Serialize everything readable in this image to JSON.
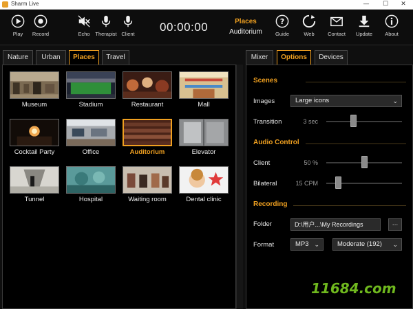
{
  "window": {
    "title": "Sharm Live",
    "minimize": "—",
    "maximize": "☐",
    "close": "✕"
  },
  "toolbar": {
    "play": "Play",
    "record": "Record",
    "echo": "Echo",
    "therapist": "Therapist",
    "client": "Client",
    "timer": "00:00:00",
    "scene_category": "Places",
    "scene_name": "Auditorium",
    "guide": "Guide",
    "web": "Web",
    "contact": "Contact",
    "update": "Update",
    "about": "About"
  },
  "left_tabs": [
    "Nature",
    "Urban",
    "Places",
    "Travel"
  ],
  "right_tabs": [
    "Mixer",
    "Options",
    "Devices"
  ],
  "scenes": [
    {
      "label": "Museum",
      "icon": "museum-thumbnail"
    },
    {
      "label": "Stadium",
      "icon": "stadium-thumbnail"
    },
    {
      "label": "Restaurant",
      "icon": "restaurant-thumbnail"
    },
    {
      "label": "Mall",
      "icon": "mall-thumbnail"
    },
    {
      "label": "Cocktail Party",
      "icon": "cocktail-party-thumbnail"
    },
    {
      "label": "Office",
      "icon": "office-thumbnail"
    },
    {
      "label": "Auditorium",
      "icon": "auditorium-thumbnail"
    },
    {
      "label": "Elevator",
      "icon": "elevator-thumbnail"
    },
    {
      "label": "Tunnel",
      "icon": "tunnel-thumbnail"
    },
    {
      "label": "Hospital",
      "icon": "hospital-thumbnail"
    },
    {
      "label": "Waiting room",
      "icon": "waiting-room-thumbnail"
    },
    {
      "label": "Dental clinic",
      "icon": "dental-clinic-thumbnail"
    }
  ],
  "options": {
    "scenes_header": "Scenes",
    "images_label": "Images",
    "images_value": "Large icons",
    "transition_label": "Transition",
    "transition_value": "3 sec",
    "transition_level": 0.35,
    "audio_header": "Audio Control",
    "client_label": "Client",
    "client_value": "50 %",
    "client_level": 0.5,
    "bilateral_label": "Bilateral",
    "bilateral_value": "15 CPM",
    "bilateral_level": 0.15,
    "recording_header": "Recording",
    "folder_label": "Folder",
    "folder_value": "D:\\用户...\\My Recordings",
    "browse_label": "...",
    "format_label": "Format",
    "format_value": "MP3",
    "quality_value": "Moderate (192)"
  },
  "watermark": "11684.com",
  "colors": {
    "accent": "#f0a020",
    "background": "#000000",
    "panel": "#0d0d0d"
  }
}
